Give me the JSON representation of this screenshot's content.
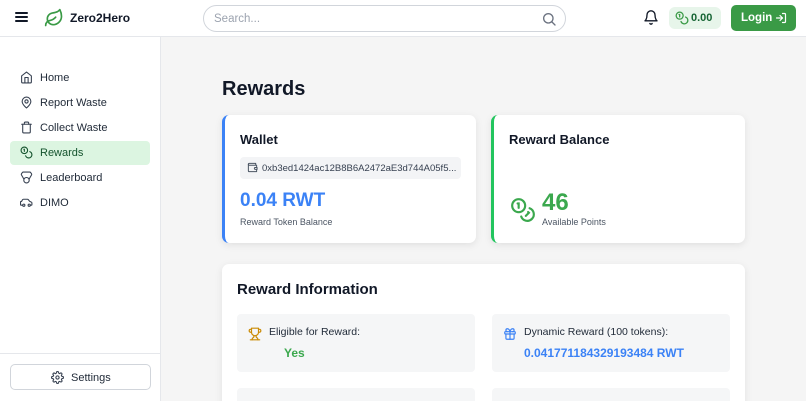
{
  "header": {
    "brand": "Zero2Hero",
    "search_placeholder": "Search...",
    "balance": "0.00",
    "login_label": "Login"
  },
  "sidebar": {
    "items": [
      {
        "label": "Home",
        "icon": "home-icon"
      },
      {
        "label": "Report Waste",
        "icon": "map-pin-icon"
      },
      {
        "label": "Collect Waste",
        "icon": "trash-icon"
      },
      {
        "label": "Rewards",
        "icon": "coins-icon",
        "active": true
      },
      {
        "label": "Leaderboard",
        "icon": "medal-icon"
      },
      {
        "label": "DIMO",
        "icon": "car-icon"
      }
    ],
    "settings_label": "Settings"
  },
  "main": {
    "page_title": "Rewards",
    "wallet": {
      "title": "Wallet",
      "address": "0xb3ed1424ac12B8B6A2472aE3d744A05f5...",
      "amount": "0.04 RWT",
      "caption": "Reward Token Balance"
    },
    "reward_balance": {
      "title": "Reward Balance",
      "points": "46",
      "caption": "Available Points"
    },
    "reward_info": {
      "title": "Reward Information",
      "eligible_label": "Eligible for Reward:",
      "eligible_value": "Yes",
      "dynamic_label": "Dynamic Reward (100 tokens):",
      "dynamic_value": "0.041771184329193484 RWT"
    }
  },
  "colors": {
    "brand_green": "#3a9a46",
    "accent_blue": "#3b82f6",
    "points_green": "#3ba84e",
    "active_nav_bg": "#dcf5e1"
  }
}
